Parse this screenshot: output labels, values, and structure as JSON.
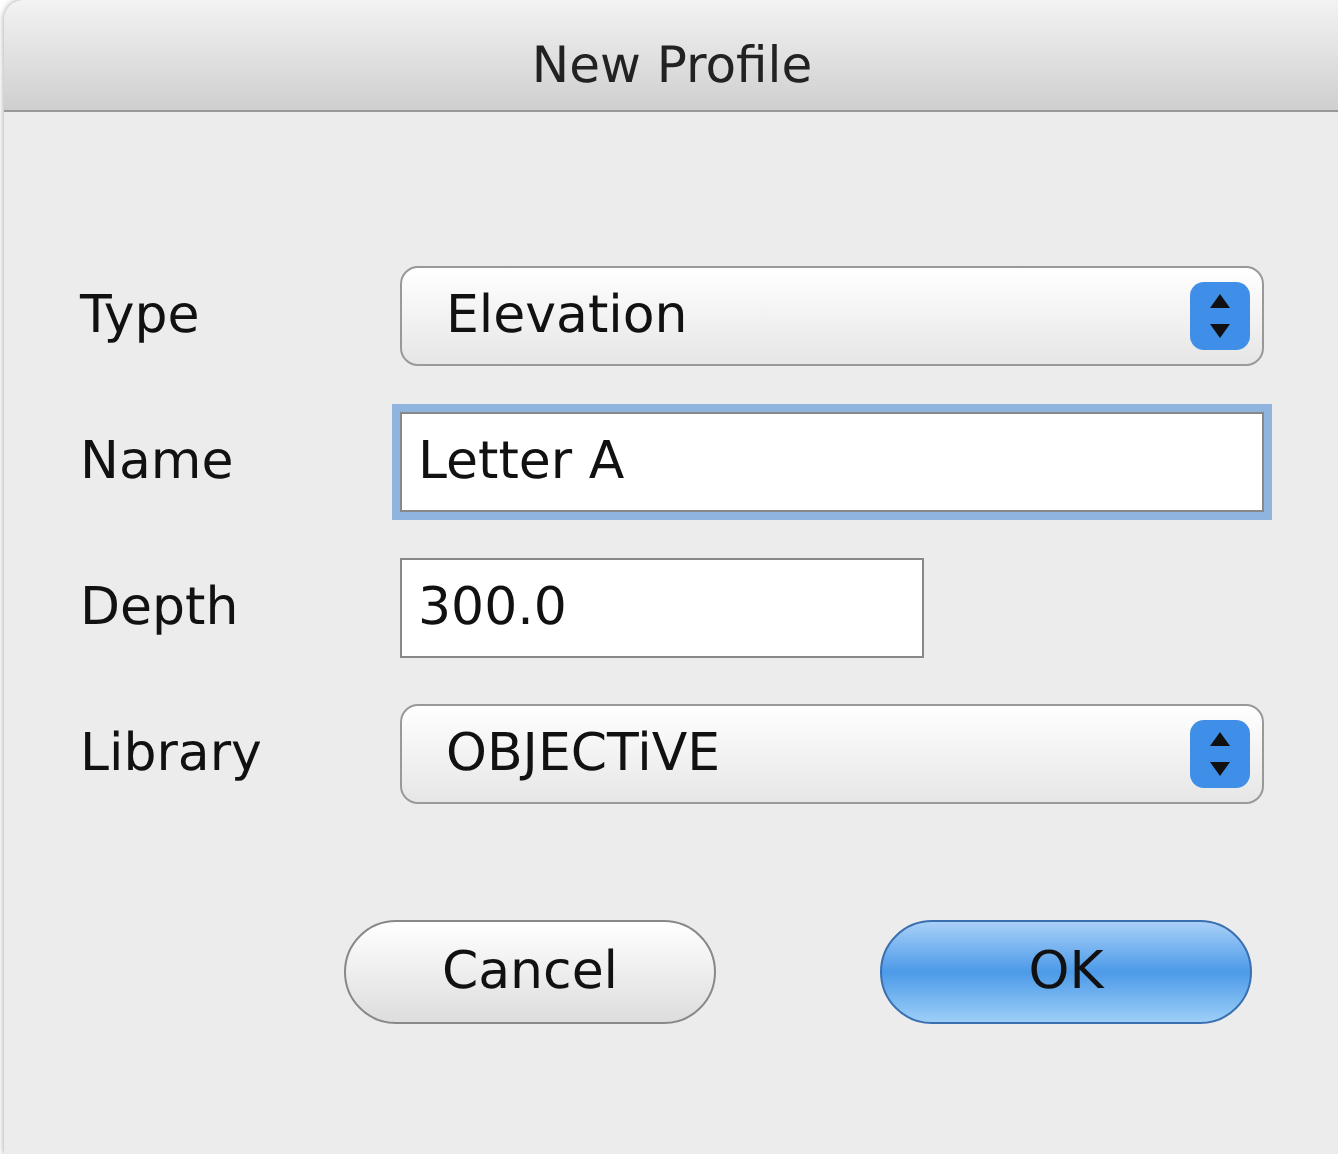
{
  "window": {
    "title": "New Profile"
  },
  "fields": [
    {
      "kind": "popup",
      "label": "Type",
      "value": "Elevation"
    },
    {
      "kind": "text",
      "label": "Name",
      "value": "Letter A",
      "focused": true,
      "wide": true
    },
    {
      "kind": "text",
      "label": "Depth",
      "value": "300.0",
      "focused": false,
      "wide": false
    },
    {
      "kind": "popup",
      "label": "Library",
      "value": "OBJECTiVE"
    }
  ],
  "buttons": [
    {
      "label": "Cancel",
      "default": false
    },
    {
      "label": "OK",
      "default": true
    }
  ]
}
